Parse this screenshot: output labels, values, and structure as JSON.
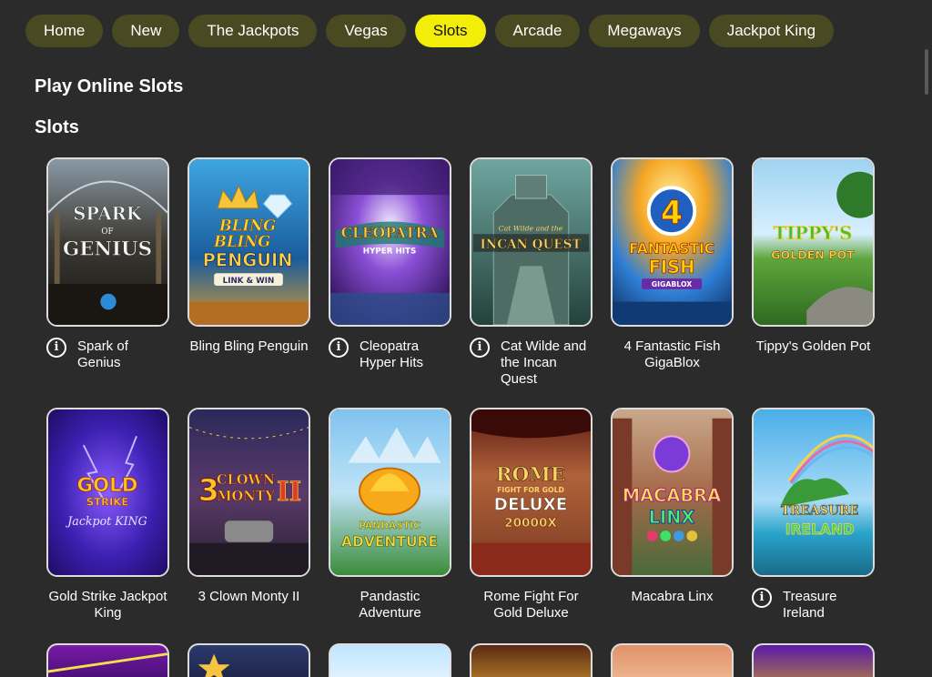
{
  "nav": {
    "items": [
      {
        "label": "Home",
        "active": false
      },
      {
        "label": "New",
        "active": false
      },
      {
        "label": "The Jackpots",
        "active": false
      },
      {
        "label": "Vegas",
        "active": false
      },
      {
        "label": "Slots",
        "active": true
      },
      {
        "label": "Arcade",
        "active": false
      },
      {
        "label": "Megaways",
        "active": false
      },
      {
        "label": "Jackpot King",
        "active": false
      }
    ]
  },
  "page_title": "Play Online Slots",
  "section_title": "Slots",
  "games": [
    {
      "name": "Spark of Genius",
      "info": true,
      "logo": [
        "SPARK",
        "OF",
        "GENIUS"
      ]
    },
    {
      "name": "Bling Bling Penguin",
      "info": false,
      "logo": [
        "BLING",
        "BLING",
        "PENGUIN",
        "LINK & WIN"
      ]
    },
    {
      "name": "Cleopatra Hyper Hits",
      "info": true,
      "logo": [
        "CLEOPATRA",
        "HYPER HITS"
      ]
    },
    {
      "name": "Cat Wilde and the Incan Quest",
      "info": true,
      "logo": [
        "Cat Wilde and the",
        "INCAN QUEST"
      ]
    },
    {
      "name": "4 Fantastic Fish GigaBlox",
      "info": false,
      "logo": [
        "4",
        "FANTASTIC",
        "FISH",
        "GIGABLOX"
      ]
    },
    {
      "name": "Tippy's Golden Pot",
      "info": false,
      "logo": [
        "TIPPY'S",
        "GOLDEN POT"
      ]
    },
    {
      "name": "Gold Strike Jackpot King",
      "info": false,
      "logo": [
        "GOLD",
        "STRIKE",
        "Jackpot KING"
      ]
    },
    {
      "name": "3 Clown Monty II",
      "info": false,
      "logo": [
        "3",
        "CLOWN",
        "MONTY",
        "II"
      ]
    },
    {
      "name": "Pandastic Adventure",
      "info": false,
      "logo": [
        "PANDASTIC",
        "ADVENTURE"
      ]
    },
    {
      "name": "Rome Fight For Gold Deluxe",
      "info": false,
      "logo": [
        "ROME",
        "FIGHT FOR GOLD",
        "DELUXE",
        "20000X"
      ]
    },
    {
      "name": "Macabra Linx",
      "info": false,
      "logo": [
        "MACABRA",
        "LINX"
      ]
    },
    {
      "name": "Treasure Ireland",
      "info": true,
      "logo": [
        "TREASURE",
        "IRELAND"
      ]
    }
  ],
  "info_glyph": "i",
  "colors": {
    "background": "#2b2b2b",
    "pill": "#4a4a22",
    "pill_active": "#f2ee0a"
  }
}
